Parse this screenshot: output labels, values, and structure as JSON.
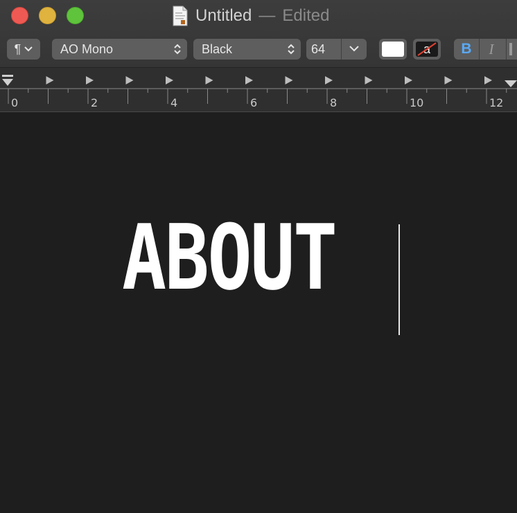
{
  "window": {
    "title": "Untitled",
    "title_separator": "—",
    "title_state": "Edited",
    "traffic_lights": [
      "close",
      "minimize",
      "maximize"
    ]
  },
  "toolbar": {
    "paragraph_icon": "¶",
    "font_family": "AO Mono",
    "font_weight": "Black",
    "font_size": "64",
    "text_color": "#ffffff",
    "background_color": "none",
    "background_swatch_glyph": "a",
    "bold_label": "B",
    "italic_label": "I",
    "bold_active": true
  },
  "ruler": {
    "labels": [
      "0",
      "2",
      "4",
      "6",
      "8",
      "10",
      "12"
    ]
  },
  "document": {
    "text": "ABOUT",
    "background": "#1e1e1e",
    "text_color": "#ffffff"
  },
  "icons": {
    "document": "document-icon",
    "updown": "updown-chevron-icon",
    "dropdown": "chevron-down-icon",
    "strike": "strike-slash-icon"
  }
}
